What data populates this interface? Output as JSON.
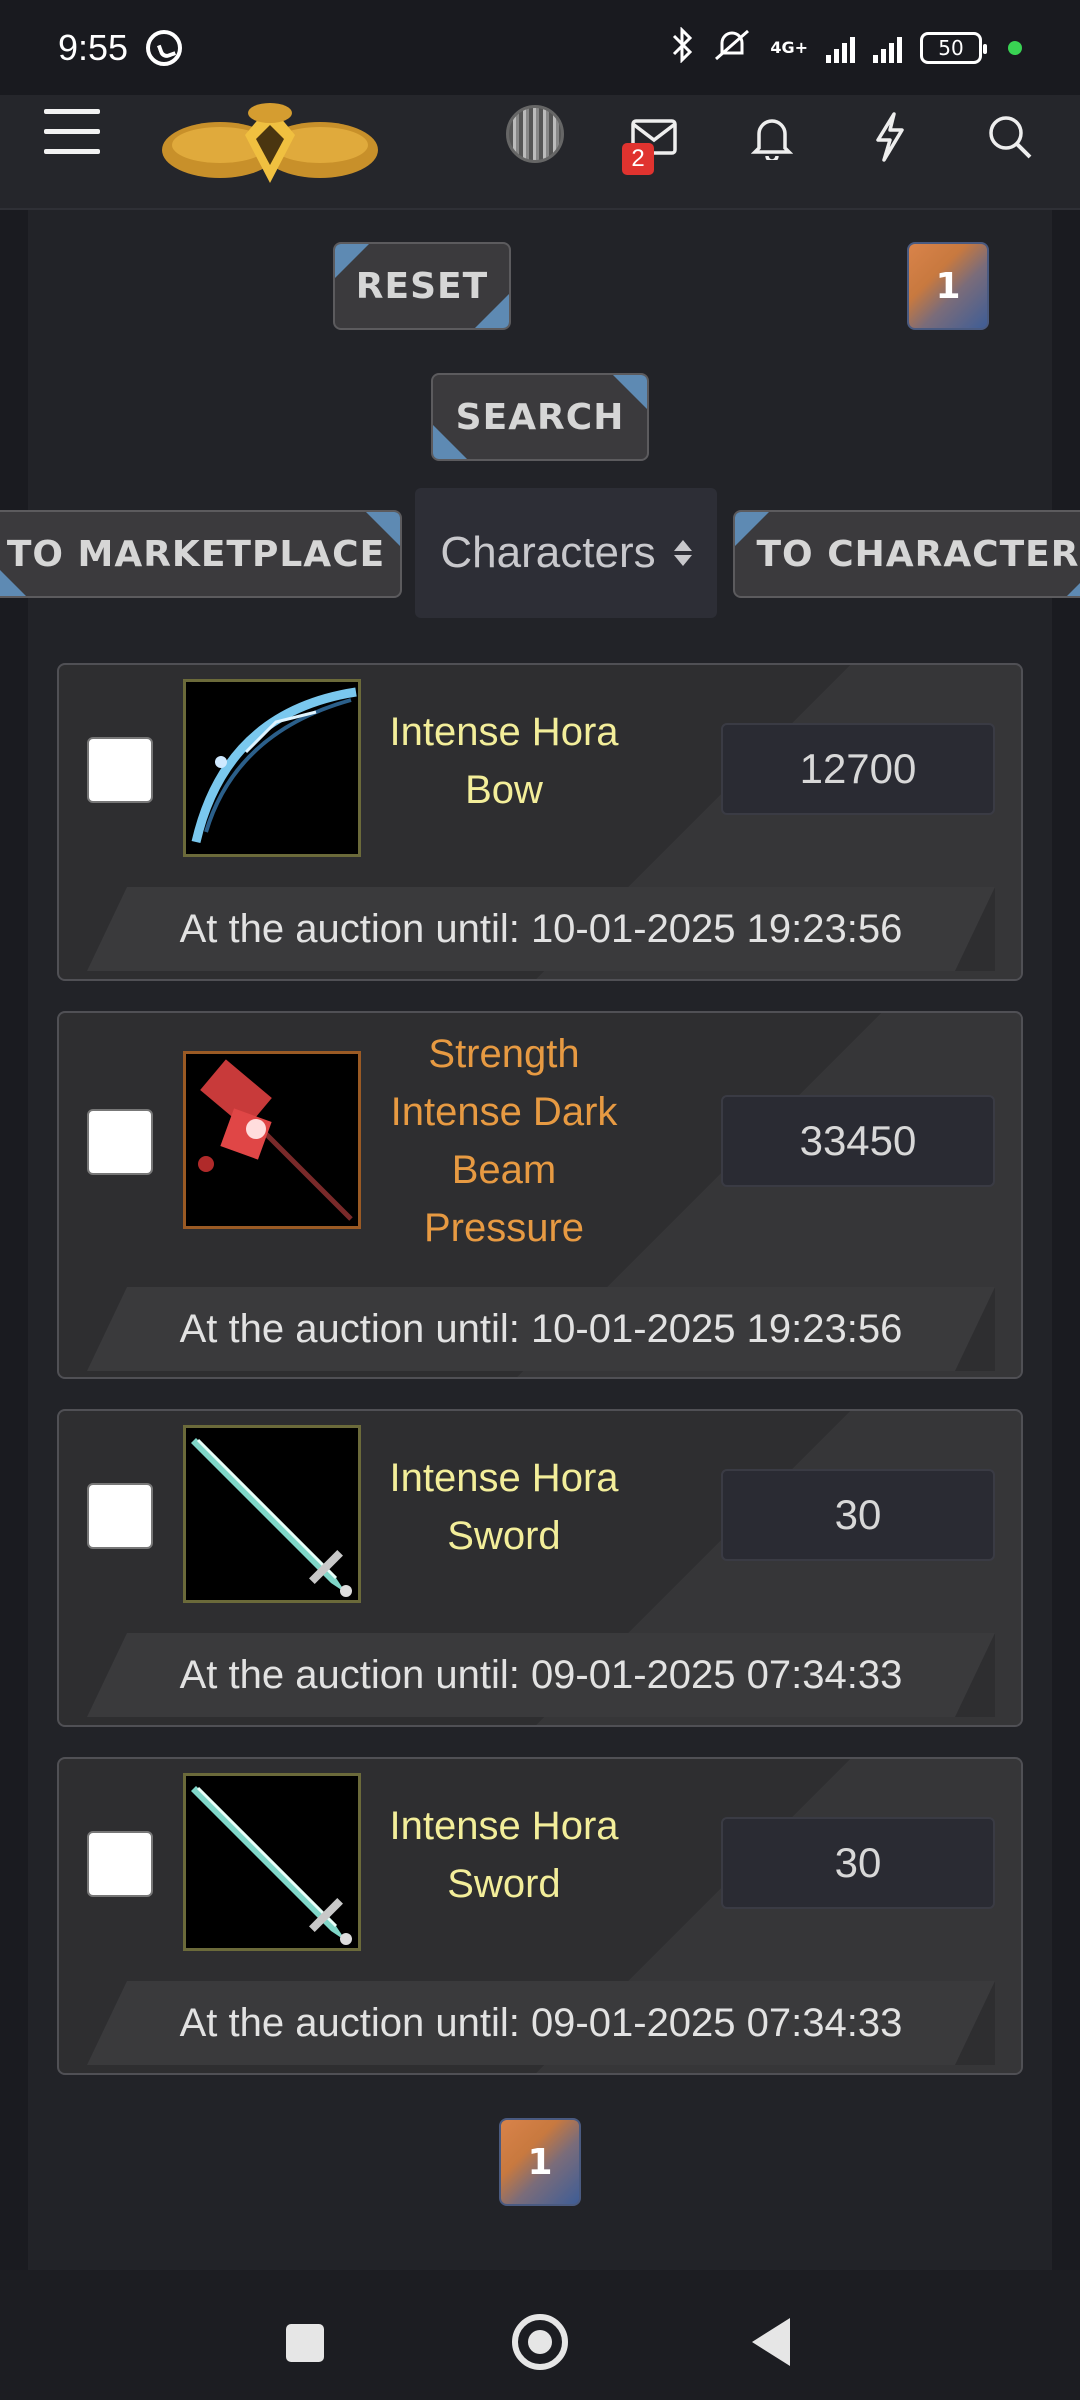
{
  "status_bar": {
    "time": "9:55",
    "network": "4G+",
    "battery": "50"
  },
  "nav": {
    "mail_badge": "2"
  },
  "controls": {
    "reset_label": "RESET",
    "search_label": "SEARCH",
    "page_top": "1",
    "to_marketplace_label": "TO MARKETPLACE",
    "to_character_label": "TO CHARACTER",
    "select_value": "Characters",
    "page_bottom": "1"
  },
  "listings": [
    {
      "name_line1": "Intense Hora",
      "name_line2": "Bow",
      "name_line3": "",
      "name_line4": "",
      "price": "12700",
      "until": "At the auction until: 10-01-2025 19:23:56",
      "rarity_color": "#f3ee9a",
      "icon": "bow-icon"
    },
    {
      "name_line1": "Strength",
      "name_line2": "Intense Dark",
      "name_line3": "Beam",
      "name_line4": "Pressure",
      "price": "33450",
      "until": "At the auction until: 10-01-2025 19:23:56",
      "rarity_color": "#e79a42",
      "icon": "staff-icon"
    },
    {
      "name_line1": "Intense Hora",
      "name_line2": "Sword",
      "name_line3": "",
      "name_line4": "",
      "price": "30",
      "until": "At the auction until: 09-01-2025 07:34:33",
      "rarity_color": "#f3ee9a",
      "icon": "sword-icon"
    },
    {
      "name_line1": "Intense Hora",
      "name_line2": "Sword",
      "name_line3": "",
      "name_line4": "",
      "price": "30",
      "until": "At the auction until: 09-01-2025 07:34:33",
      "rarity_color": "#f3ee9a",
      "icon": "sword-icon"
    }
  ],
  "colors": {
    "accent_corner": "#5e8ab3",
    "rarity_yellow": "#f3ee9a",
    "rarity_orange": "#e79a42"
  }
}
